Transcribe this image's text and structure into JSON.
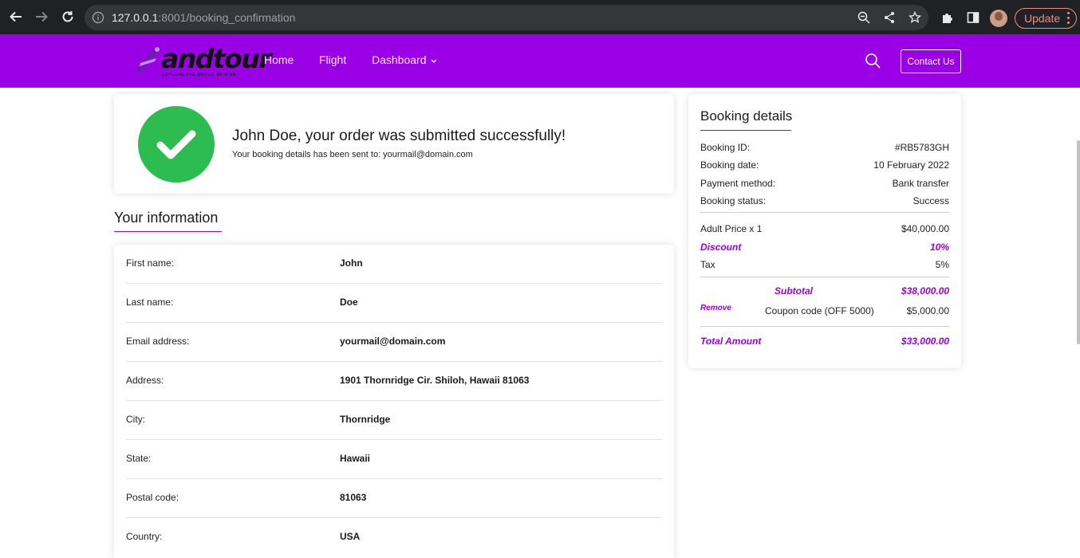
{
  "browser": {
    "url_host": "127.0.0.1",
    "url_rest": ":8001/booking_confirmation",
    "update_label": "Update"
  },
  "header": {
    "logo_word": "andtour",
    "logo_tagline": "EXPLORE THE WORLD WITH US",
    "menu": [
      "Home",
      "Flight",
      "Dashboard"
    ],
    "contact_label": "Contact Us",
    "brand_color": "#9a00e6"
  },
  "success": {
    "title": "John Doe, your order was submitted successfully!",
    "subtitle": "Your booking details has been sent to: yourmail@domain.com",
    "icon": "check-icon",
    "color": "#2cbc4f"
  },
  "info": {
    "title": "Your information",
    "rows": [
      {
        "label": "First name:",
        "value": "John"
      },
      {
        "label": "Last name:",
        "value": "Doe"
      },
      {
        "label": "Email address:",
        "value": "yourmail@domain.com"
      },
      {
        "label": "Address:",
        "value": "1901 Thornridge Cir. Shiloh, Hawaii 81063"
      },
      {
        "label": "City:",
        "value": "Thornridge"
      },
      {
        "label": "State:",
        "value": "Hawaii"
      },
      {
        "label": "Postal code:",
        "value": "81063"
      },
      {
        "label": "Country:",
        "value": "USA"
      }
    ]
  },
  "details": {
    "title": "Booking details",
    "booking_id_label": "Booking ID:",
    "booking_id": "#RB5783GH",
    "booking_date_label": "Booking date:",
    "booking_date": "10 February 2022",
    "payment_label": "Payment method:",
    "payment": "Bank transfer",
    "status_label": "Booking status:",
    "status": "Success",
    "adult_label": "Adult Price x 1",
    "adult": "$40,000.00",
    "discount_label": "Discount",
    "discount": "10%",
    "tax_label": "Tax",
    "tax": "5%",
    "subtotal_label": "Subtotal",
    "subtotal": "$38,000.00",
    "remove_label": "Remove",
    "coupon_label": "Coupon code (OFF 5000)",
    "coupon": "$5,000.00",
    "total_label": "Total Amount",
    "total": "$33,000.00"
  }
}
